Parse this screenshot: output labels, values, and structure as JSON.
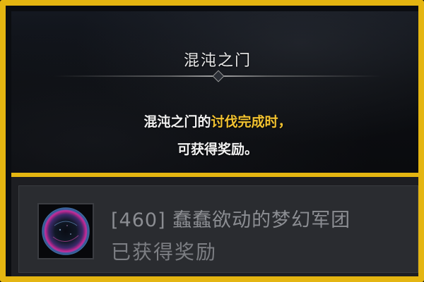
{
  "panel": {
    "title": "混沌之门",
    "description_line1_prefix": "混沌之门的",
    "description_line1_highlight": "讨伐完成时，",
    "description_line2": "可获得奖励。"
  },
  "reward": {
    "icon": "purple-vortex-portal-icon",
    "name": "[460] 蠢蠢欲动的梦幻军团",
    "status": "已获得奖励"
  },
  "colors": {
    "frame_border": "#e4b511",
    "highlight_text": "#f2c230",
    "panel_bg": "#0b0d11",
    "reward_row_bg": "#2a2c30",
    "muted_text": "#8b8d92"
  }
}
